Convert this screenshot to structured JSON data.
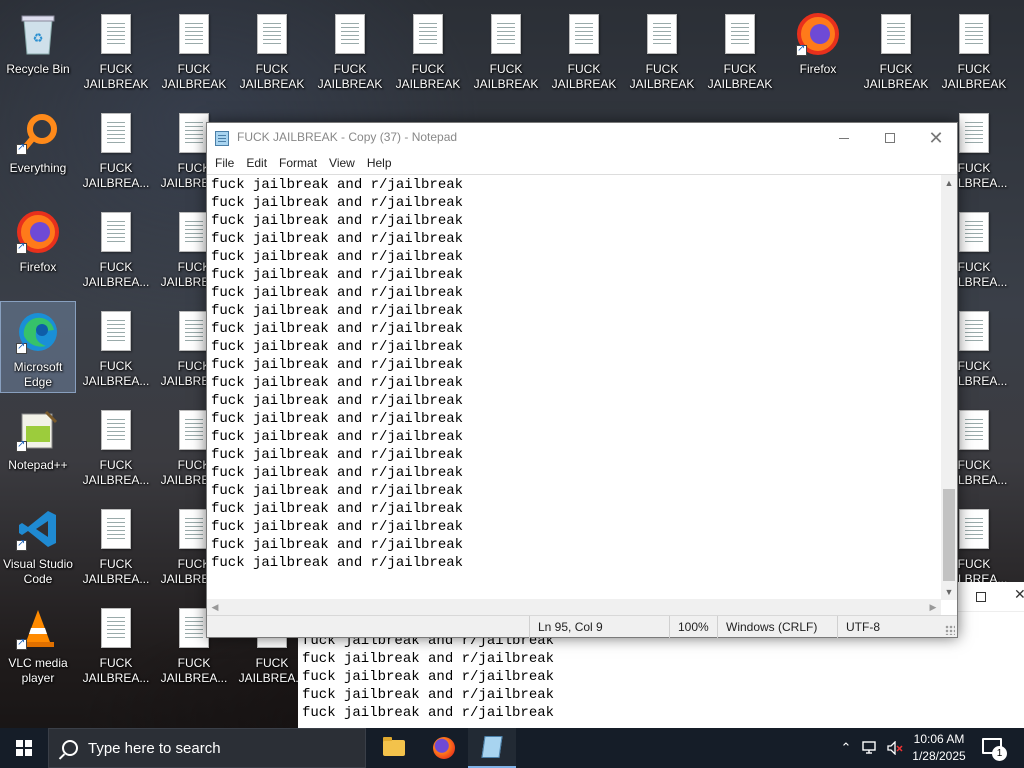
{
  "desktop": {
    "icons": [
      {
        "id": "recycle-bin",
        "label": "Recycle Bin"
      },
      {
        "id": "everything",
        "label": "Everything"
      },
      {
        "id": "firefox-left",
        "label": "Firefox"
      },
      {
        "id": "edge",
        "label": "Microsoft Edge"
      },
      {
        "id": "notepadpp",
        "label": "Notepad++"
      },
      {
        "id": "vscode",
        "label": "Visual Studio Code"
      },
      {
        "id": "vlc",
        "label": "VLC media player"
      },
      {
        "id": "firefox-top",
        "label": "Firefox"
      }
    ],
    "file_label_short": "FUCK JAILBREAK",
    "file_label_truncated": "FUCK JAILBREA..."
  },
  "notepad": {
    "title": "FUCK JAILBREAK - Copy (37) - Notepad",
    "menu": [
      "File",
      "Edit",
      "Format",
      "View",
      "Help"
    ],
    "line_text": "fuck jailbreak and r/jailbreak",
    "visible_lines": 22,
    "status": {
      "position": "Ln 95, Col 9",
      "zoom": "100%",
      "line_ending": "Windows (CRLF)",
      "encoding": "UTF-8"
    },
    "scroll": {
      "vertical_fraction": 0.85
    }
  },
  "background_notepad": {
    "line_text": "fuck jailbreak and r/jailbreak",
    "visible_lines": 5
  },
  "taskbar": {
    "search_placeholder": "Type here to search",
    "apps": [
      "file-explorer",
      "firefox",
      "notepad"
    ],
    "time": "10:06 AM",
    "date": "1/28/2025",
    "notification_count": "1"
  }
}
